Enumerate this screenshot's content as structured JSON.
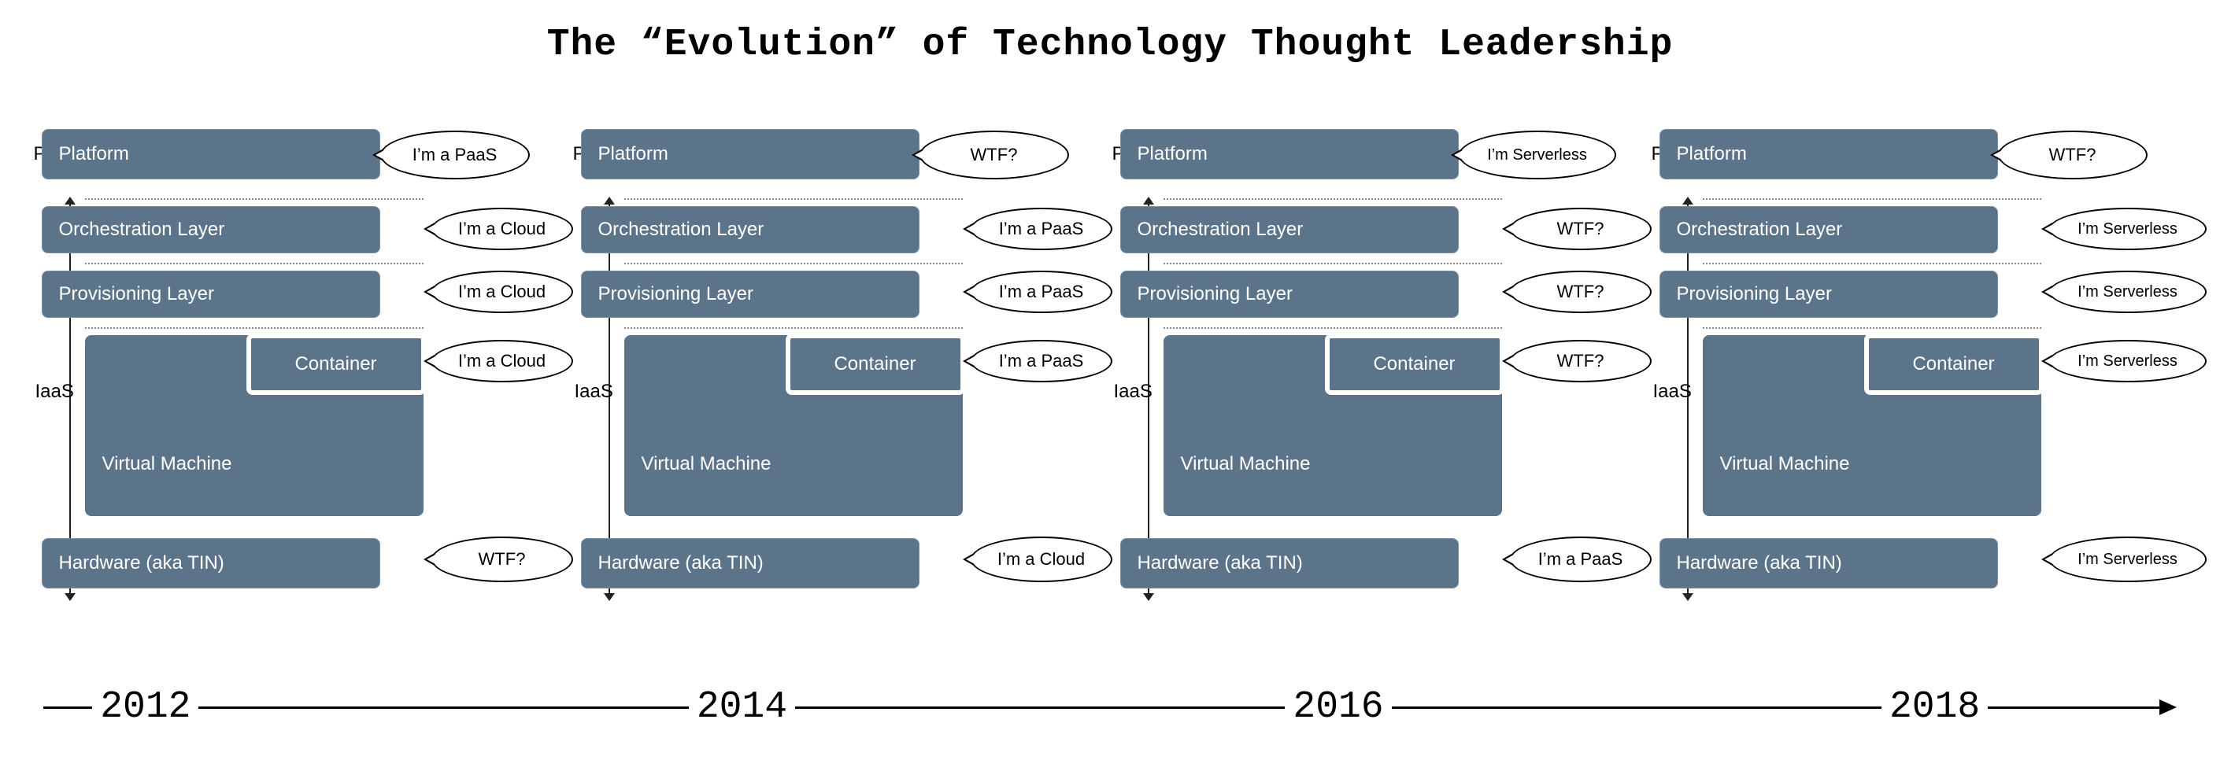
{
  "title": "The “Evolution” of Technology Thought Leadership",
  "axis": {
    "paas": "PaaS",
    "iaas": "IaaS"
  },
  "layers": {
    "platform": "Platform",
    "orchestration": "Orchestration Layer",
    "provisioning": "Provisioning Layer",
    "container": "Container",
    "vm": "Virtual Machine",
    "hardware": "Hardware (aka TIN)"
  },
  "panels": [
    {
      "year": "2012",
      "bubbles": {
        "platform": "I’m a PaaS",
        "orchestration": "I’m a Cloud",
        "provisioning": "I’m a Cloud",
        "container": "I’m a Cloud",
        "hardware": "WTF?"
      }
    },
    {
      "year": "2014",
      "bubbles": {
        "platform": "WTF?",
        "orchestration": "I’m a PaaS",
        "provisioning": "I’m a PaaS",
        "container": "I’m a PaaS",
        "hardware": "I’m a Cloud"
      }
    },
    {
      "year": "2016",
      "bubbles": {
        "platform": "I’m Serverless",
        "orchestration": "WTF?",
        "provisioning": "WTF?",
        "container": "WTF?",
        "hardware": "I’m a PaaS"
      }
    },
    {
      "year": "2018",
      "bubbles": {
        "platform": "WTF?",
        "orchestration": "I’m Serverless",
        "provisioning": "I’m Serverless",
        "container": "I’m Serverless",
        "hardware": "I’m Serverless"
      }
    }
  ]
}
